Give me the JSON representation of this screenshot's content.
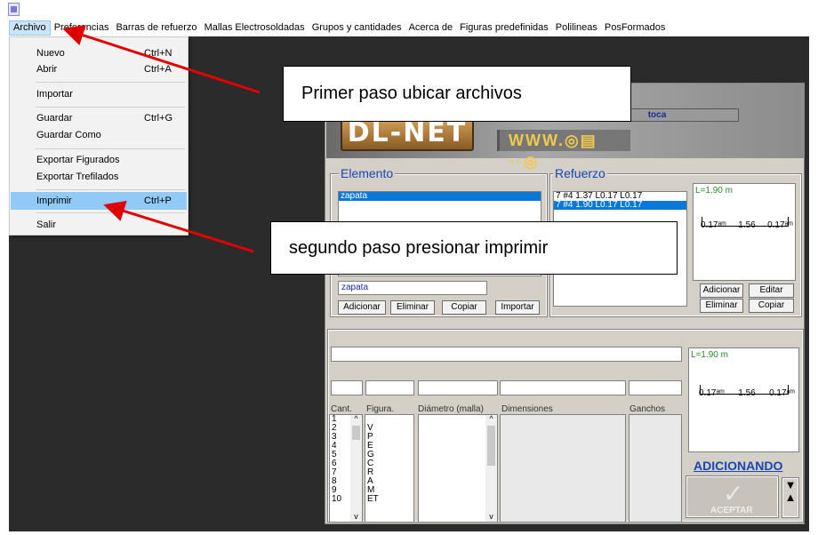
{
  "menubar": {
    "items": [
      "Archivo",
      "Preferencias",
      "Barras de refuerzo",
      "Mallas Electrosoldadas",
      "Grupos y cantidades",
      "Acerca de",
      "Figuras predefinidas",
      "Polilineas",
      "PosFormados"
    ]
  },
  "file_menu": {
    "items": [
      {
        "label": "Nuevo",
        "shortcut": "Ctrl+N"
      },
      {
        "label": "Abrir",
        "shortcut": "Ctrl+A"
      },
      {
        "label": "Importar",
        "shortcut": ""
      },
      {
        "label": "Guardar",
        "shortcut": "Ctrl+G"
      },
      {
        "label": "Guardar Como",
        "shortcut": ""
      },
      {
        "label": "Exportar Figurados",
        "shortcut": ""
      },
      {
        "label": "Exportar Trefilados",
        "shortcut": ""
      },
      {
        "label": "Imprimir",
        "shortcut": "Ctrl+P"
      },
      {
        "label": "Salir",
        "shortcut": ""
      }
    ]
  },
  "app": {
    "logo": "DL-NET",
    "www_text": "WWW.◎▤ ◦◦◎",
    "toca": "toca"
  },
  "elemento": {
    "title": "Elemento",
    "items": [
      "zapata"
    ],
    "input_value": "zapata",
    "buttons": {
      "add": "Adicionar",
      "delete": "Eliminar",
      "copy": "Copiar",
      "import": "Importar"
    }
  },
  "refuerzo": {
    "title": "Refuerzo",
    "items": [
      "7 #4 1.37 L0.17 L0.17",
      "7 #4 1.90 L0.17 L0.17"
    ],
    "preview": {
      "length": "L=1.90 m",
      "left": "0.17ᵃᵐ",
      "mid": "1.56",
      "right": "0.17ᵃᵐ"
    },
    "buttons": {
      "add": "Adicionar",
      "edit": "Editar",
      "delete": "Eliminar",
      "copy": "Copiar"
    }
  },
  "bottom": {
    "headers": {
      "cant": "Cant.",
      "figura": "Figura.",
      "diametro": "Diámetro (malla)",
      "dimensiones": "Dimensiones",
      "ganchos": "Ganchos"
    },
    "cant_list": [
      "1",
      "2",
      "3",
      "4",
      "5",
      "6",
      "7",
      "8",
      "9",
      "10"
    ],
    "fig_list": [
      "",
      "V",
      "P",
      "E",
      "G",
      "C",
      "R",
      "A",
      "M",
      "ET"
    ],
    "preview": {
      "length": "L=1.90 m",
      "left": "0.17ᵃᵐ",
      "mid": "1.56",
      "right": "0.17ᵃᵐ"
    },
    "status": "ADICIONANDO",
    "accept": "ACEPTAR"
  },
  "annotations": {
    "step1": "Primer paso ubicar archivos",
    "step2": "segundo paso presionar imprimir"
  }
}
